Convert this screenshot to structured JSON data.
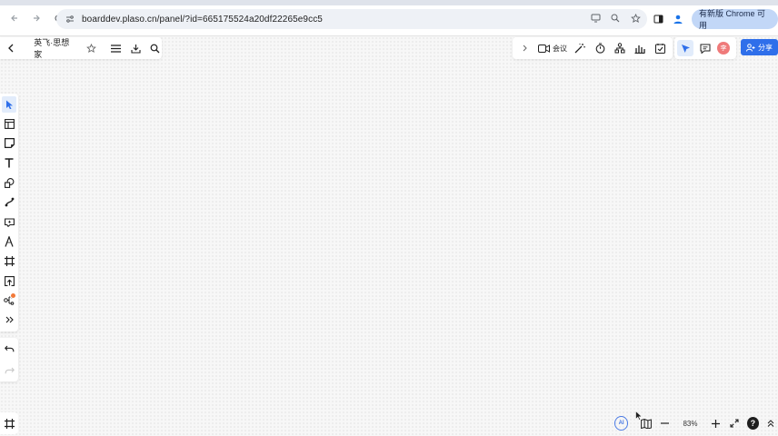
{
  "browser": {
    "url": "boarddev.plaso.cn/panel/?id=665175524a20df22265e9cc5",
    "update_label": "有新版 Chrome 可用"
  },
  "doc": {
    "title": "英飞·思想家"
  },
  "top_tools": {
    "meeting_label": "会议"
  },
  "user": {
    "avatar_initial": "李"
  },
  "share": {
    "label": "分享"
  },
  "zoom": {
    "level": "83%",
    "ai_label": "AI",
    "help_label": "?"
  },
  "colors": {
    "accent": "#2f6fea",
    "active_tool_bg": "#e2ecfb",
    "badge": "#f27a3a",
    "avatar": "#ef7a7a"
  },
  "left_tools": [
    "select-icon",
    "template-icon",
    "sticky-note-icon",
    "text-icon",
    "shape-icon",
    "connector-icon",
    "ai-card-icon",
    "pen-icon",
    "frame-icon",
    "upload-icon",
    "mindmap-icon",
    "more-icon"
  ]
}
